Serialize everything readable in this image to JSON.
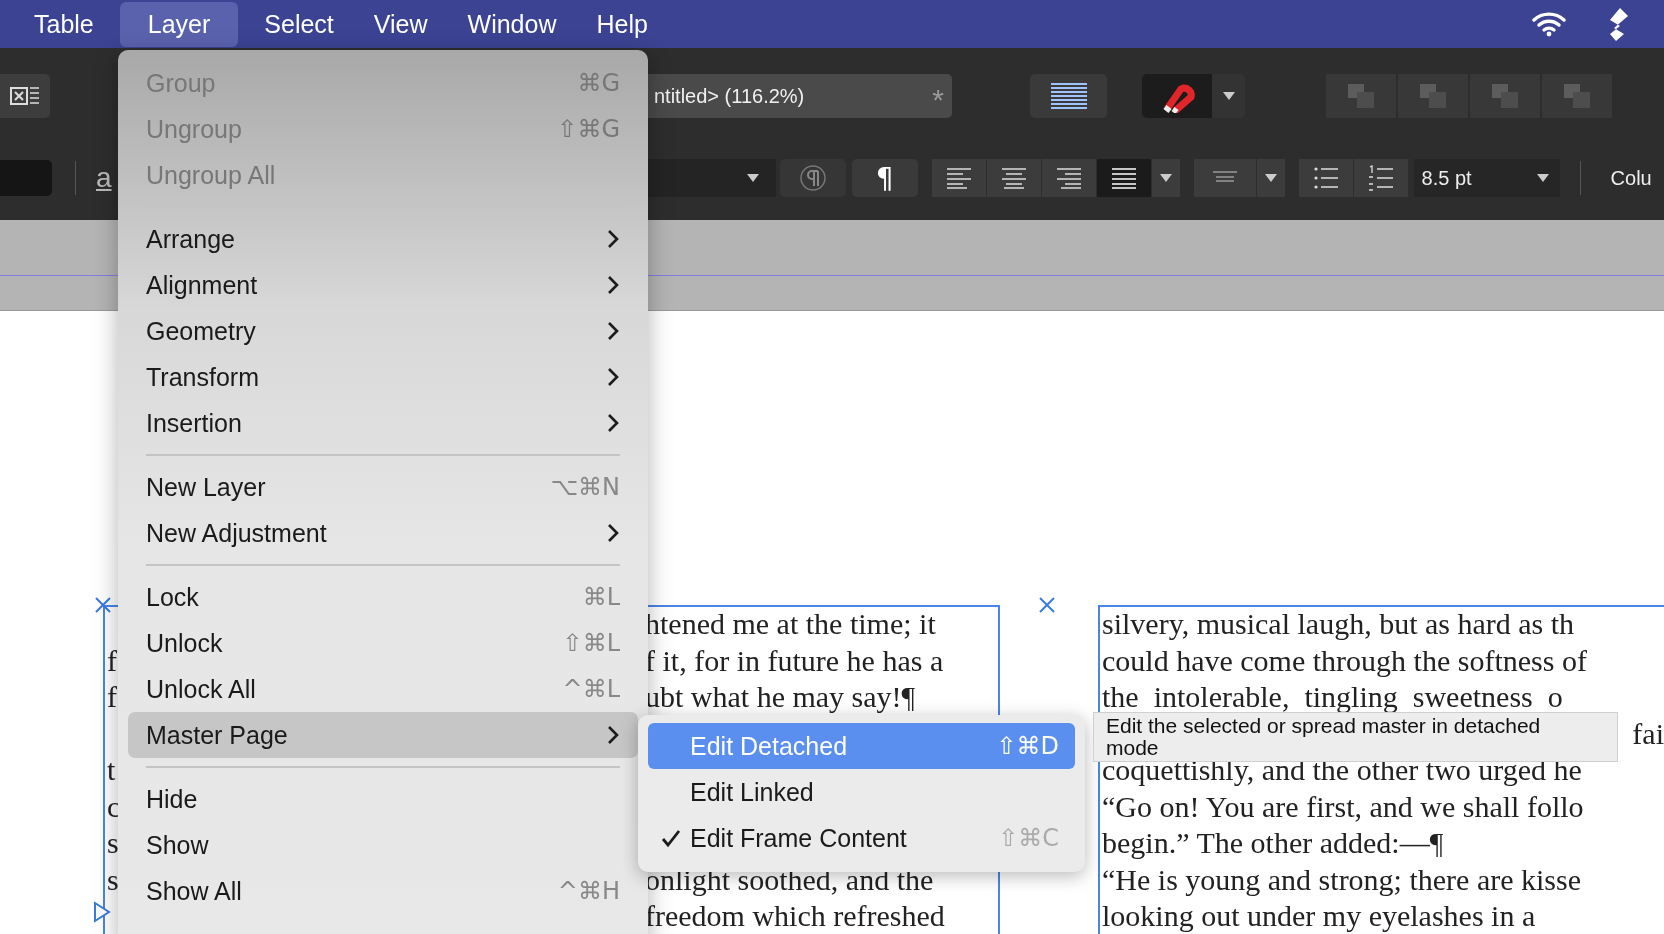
{
  "menubar": {
    "items": [
      {
        "label": "Table",
        "selected": false
      },
      {
        "label": "Layer",
        "selected": true
      },
      {
        "label": "Select",
        "selected": false
      },
      {
        "label": "View",
        "selected": false
      },
      {
        "label": "Window",
        "selected": false
      },
      {
        "label": "Help",
        "selected": false
      }
    ]
  },
  "toolbar": {
    "document_title": "ntitled> (116.2%)",
    "modified_mark": "*",
    "underline_label": "a",
    "pilcrow": "¶",
    "alignment_buttons": [
      {
        "kind": "left",
        "selected": false
      },
      {
        "kind": "center",
        "selected": false
      },
      {
        "kind": "right",
        "selected": false
      },
      {
        "kind": "justify",
        "selected": true
      }
    ],
    "font_size": "8.5 pt",
    "panel_label": "Colu"
  },
  "menu": {
    "items": [
      {
        "kind": "item",
        "label": "Group",
        "shortcut": "⌘G",
        "disabled": true,
        "submenu": false,
        "selected": false
      },
      {
        "kind": "item",
        "label": "Ungroup",
        "shortcut": "⇧⌘G",
        "disabled": true,
        "submenu": false,
        "selected": false
      },
      {
        "kind": "item",
        "label": "Ungroup All",
        "disabled": true,
        "submenu": false,
        "selected": false
      },
      {
        "kind": "separator"
      },
      {
        "kind": "item",
        "label": "Arrange",
        "disabled": false,
        "submenu": true,
        "selected": false
      },
      {
        "kind": "item",
        "label": "Alignment",
        "disabled": false,
        "submenu": true,
        "selected": false
      },
      {
        "kind": "item",
        "label": "Geometry",
        "disabled": false,
        "submenu": true,
        "selected": false
      },
      {
        "kind": "item",
        "label": "Transform",
        "disabled": false,
        "submenu": true,
        "selected": false
      },
      {
        "kind": "item",
        "label": "Insertion",
        "disabled": false,
        "submenu": true,
        "selected": false
      },
      {
        "kind": "separator"
      },
      {
        "kind": "item",
        "label": "New Layer",
        "shortcut": "⌥⌘N",
        "disabled": false,
        "submenu": false,
        "selected": false
      },
      {
        "kind": "item",
        "label": "New Adjustment",
        "disabled": false,
        "submenu": true,
        "selected": false
      },
      {
        "kind": "separator"
      },
      {
        "kind": "item",
        "label": "Lock",
        "shortcut": "⌘L",
        "disabled": false,
        "submenu": false,
        "selected": false
      },
      {
        "kind": "item",
        "label": "Unlock",
        "shortcut": "⇧⌘L",
        "disabled": false,
        "submenu": false,
        "selected": false
      },
      {
        "kind": "item",
        "label": "Unlock All",
        "shortcut": "^⌘L",
        "disabled": false,
        "submenu": false,
        "selected": false
      },
      {
        "kind": "item",
        "label": "Master Page",
        "disabled": false,
        "submenu": true,
        "selected": true
      },
      {
        "kind": "separator"
      },
      {
        "kind": "item",
        "label": "Hide",
        "disabled": false,
        "submenu": false,
        "selected": false
      },
      {
        "kind": "item",
        "label": "Show",
        "disabled": false,
        "submenu": false,
        "selected": false
      },
      {
        "kind": "item",
        "label": "Show All",
        "shortcut": "^⌘H",
        "disabled": false,
        "submenu": false,
        "selected": false
      }
    ]
  },
  "submenu": {
    "items": [
      {
        "label": "Edit Detached",
        "shortcut": "⇧⌘D",
        "shortcut_dimmed": false,
        "checked": false,
        "selected": true
      },
      {
        "label": "Edit Linked",
        "checked": false,
        "selected": false
      },
      {
        "label": "Edit Frame Content",
        "shortcut": "⇧⌘C",
        "shortcut_dimmed": true,
        "checked": true,
        "selected": false
      }
    ]
  },
  "tooltip": {
    "text": "Edit the selected or spread master in detached mode"
  },
  "document": {
    "left_frame": {
      "lines": [
        {
          "kind": "text",
          "end": "htened me at the time; it"
        },
        {
          "kind": "text",
          "start": "f",
          "end": "f it, for in future he has a"
        },
        {
          "kind": "text",
          "start": "f",
          "end": "ubt what he may say!¶"
        },
        {
          "kind": "covered"
        },
        {
          "kind": "text",
          "start": "t"
        },
        {
          "kind": "text",
          "start": "c"
        },
        {
          "kind": "text",
          "start": "s"
        },
        {
          "kind": "text",
          "start": "s",
          "end": "onlight soothed, and the"
        },
        {
          "kind": "text",
          "end": "freedom which refreshed"
        }
      ]
    },
    "right_frame": {
      "lines": [
        {
          "kind": "full",
          "text": "silvery, musical laugh, but as hard as th"
        },
        {
          "kind": "full",
          "text": "could have come through the softness of"
        },
        {
          "kind": "full",
          "text": "the  intolerable,  tingling  sweetness  o"
        },
        {
          "kind": "tail",
          "text": "fai"
        },
        {
          "kind": "full",
          "text": "coquettishly, and the other two urged he"
        },
        {
          "kind": "full",
          "text": "“Go on! You are first, and we shall follo"
        },
        {
          "kind": "full",
          "text": "begin.” The other added:—¶"
        },
        {
          "kind": "full",
          "text": "“He is young and strong; there are kisse"
        },
        {
          "kind": "full",
          "text": "looking out under my eyelashes in a"
        }
      ]
    }
  }
}
